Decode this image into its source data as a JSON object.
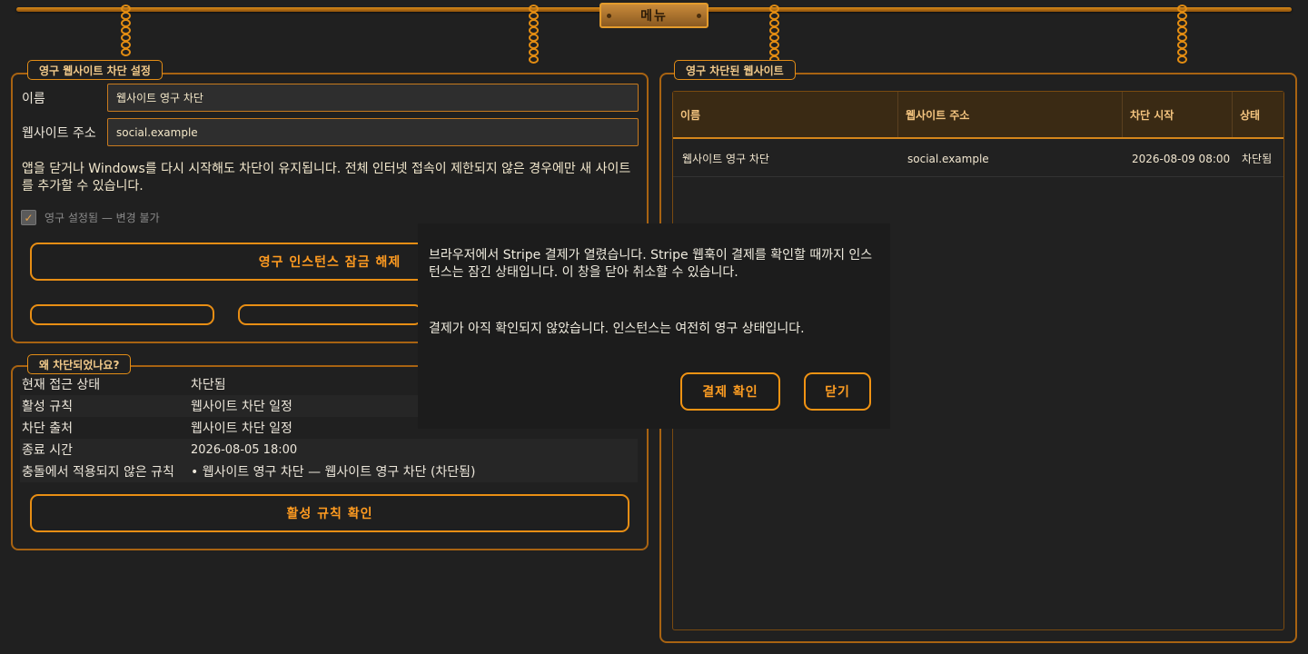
{
  "menu": {
    "label": "메뉴"
  },
  "settings": {
    "title": "영구 웹사이트 차단 설정",
    "name_label": "이름",
    "name_value": "웹사이트 영구 차단",
    "url_label": "웹사이트 주소",
    "url_value": "social.example",
    "note": "앱을 닫거나 Windows를 다시 시작해도 차단이 유지됩니다. 전체 인터넷 접속이 제한되지 않은 경우에만 새 사이트를 추가할 수 있습니다.",
    "permanent_checkbox": "영구 설정됨 — 변경 불가",
    "unlock_button": "영구 인스턴스 잠금 해제"
  },
  "why": {
    "title": "왜 차단되었나요?",
    "rows": [
      {
        "key": "현재 접근 상태",
        "value": "차단됨"
      },
      {
        "key": "활성 규칙",
        "value": "웹사이트 차단 일정"
      },
      {
        "key": "차단 출처",
        "value": "웹사이트 차단 일정"
      },
      {
        "key": "종료 시간",
        "value": "2026-08-05 18:00"
      },
      {
        "key": "충돌에서 적용되지 않은 규칙",
        "value": "• 웹사이트 영구 차단 — 웹사이트 영구 차단 (차단됨)"
      }
    ],
    "check_button": "활성 규칙 확인"
  },
  "blocked": {
    "title": "영구 차단된 웹사이트",
    "columns": [
      "이름",
      "웹사이트 주소",
      "차단 시작",
      "상태"
    ],
    "rows": [
      {
        "name": "웹사이트 영구 차단",
        "url": "social.example",
        "start": "2026-08-09 08:00",
        "status": "차단됨"
      }
    ]
  },
  "dialog": {
    "message": "브라우저에서 Stripe 결제가 열렸습니다. Stripe 웹훅이 결제를 확인할 때까지 인스턴스는 잠긴 상태입니다. 이 창을 닫아 취소할 수 있습니다.",
    "status": "결제가 아직 확인되지 않았습니다. 인스턴스는 여전히 영구 상태입니다.",
    "confirm_button": "결제 확인",
    "close_button": "닫기"
  }
}
